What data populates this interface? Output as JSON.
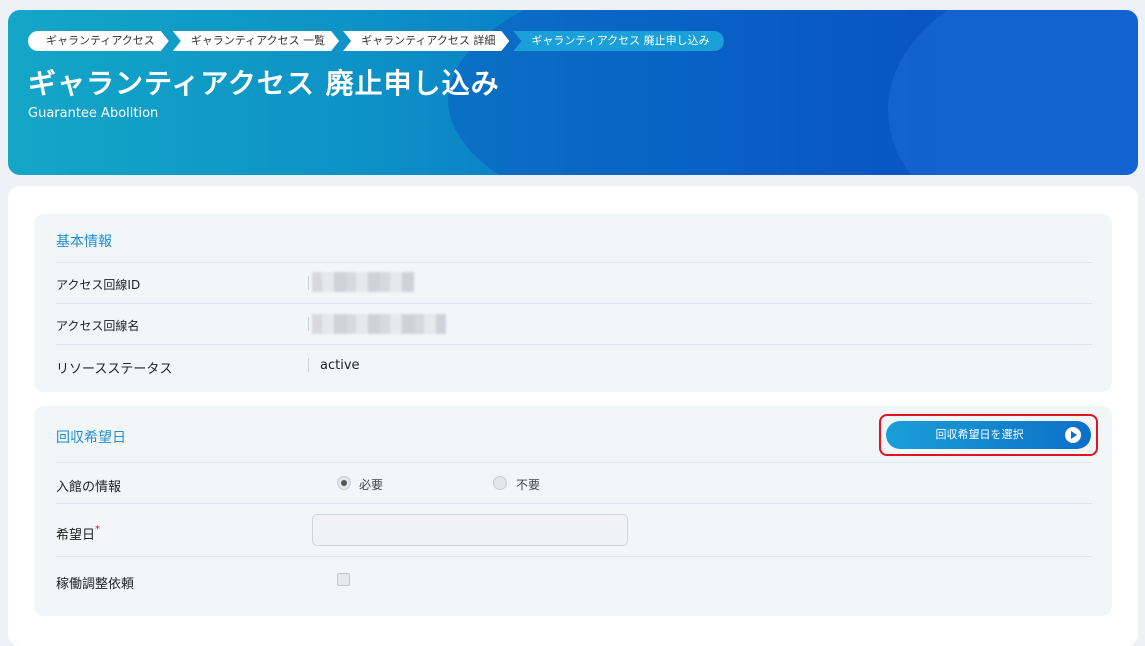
{
  "breadcrumb": [
    "ギャランティアクセス",
    "ギャランティアクセス 一覧",
    "ギャランティアクセス 詳細",
    "ギャランティアクセス 廃止申し込み"
  ],
  "header": {
    "title": "ギャランティアクセス 廃止申し込み",
    "subtitle": "Guarantee Abolition"
  },
  "basic_info": {
    "title": "基本情報",
    "rows": [
      {
        "label": "アクセス回線ID"
      },
      {
        "label": "アクセス回線名"
      },
      {
        "label": "リソースステータス",
        "value": "active"
      }
    ]
  },
  "recovery_date": {
    "title": "回収希望日",
    "select_button": "回収希望日を選択",
    "entry_label": "入館の情報",
    "entry_options": [
      "必要",
      "不要"
    ],
    "entry_selected": "必要",
    "desired_date_label": "希望日",
    "required_mark": "*",
    "desired_date_value": "",
    "operation_request_label": "稼働調整依頼",
    "operation_request_checked": false
  },
  "colors": {
    "accent": "#1a8fcf",
    "highlight": "#e0141e"
  }
}
